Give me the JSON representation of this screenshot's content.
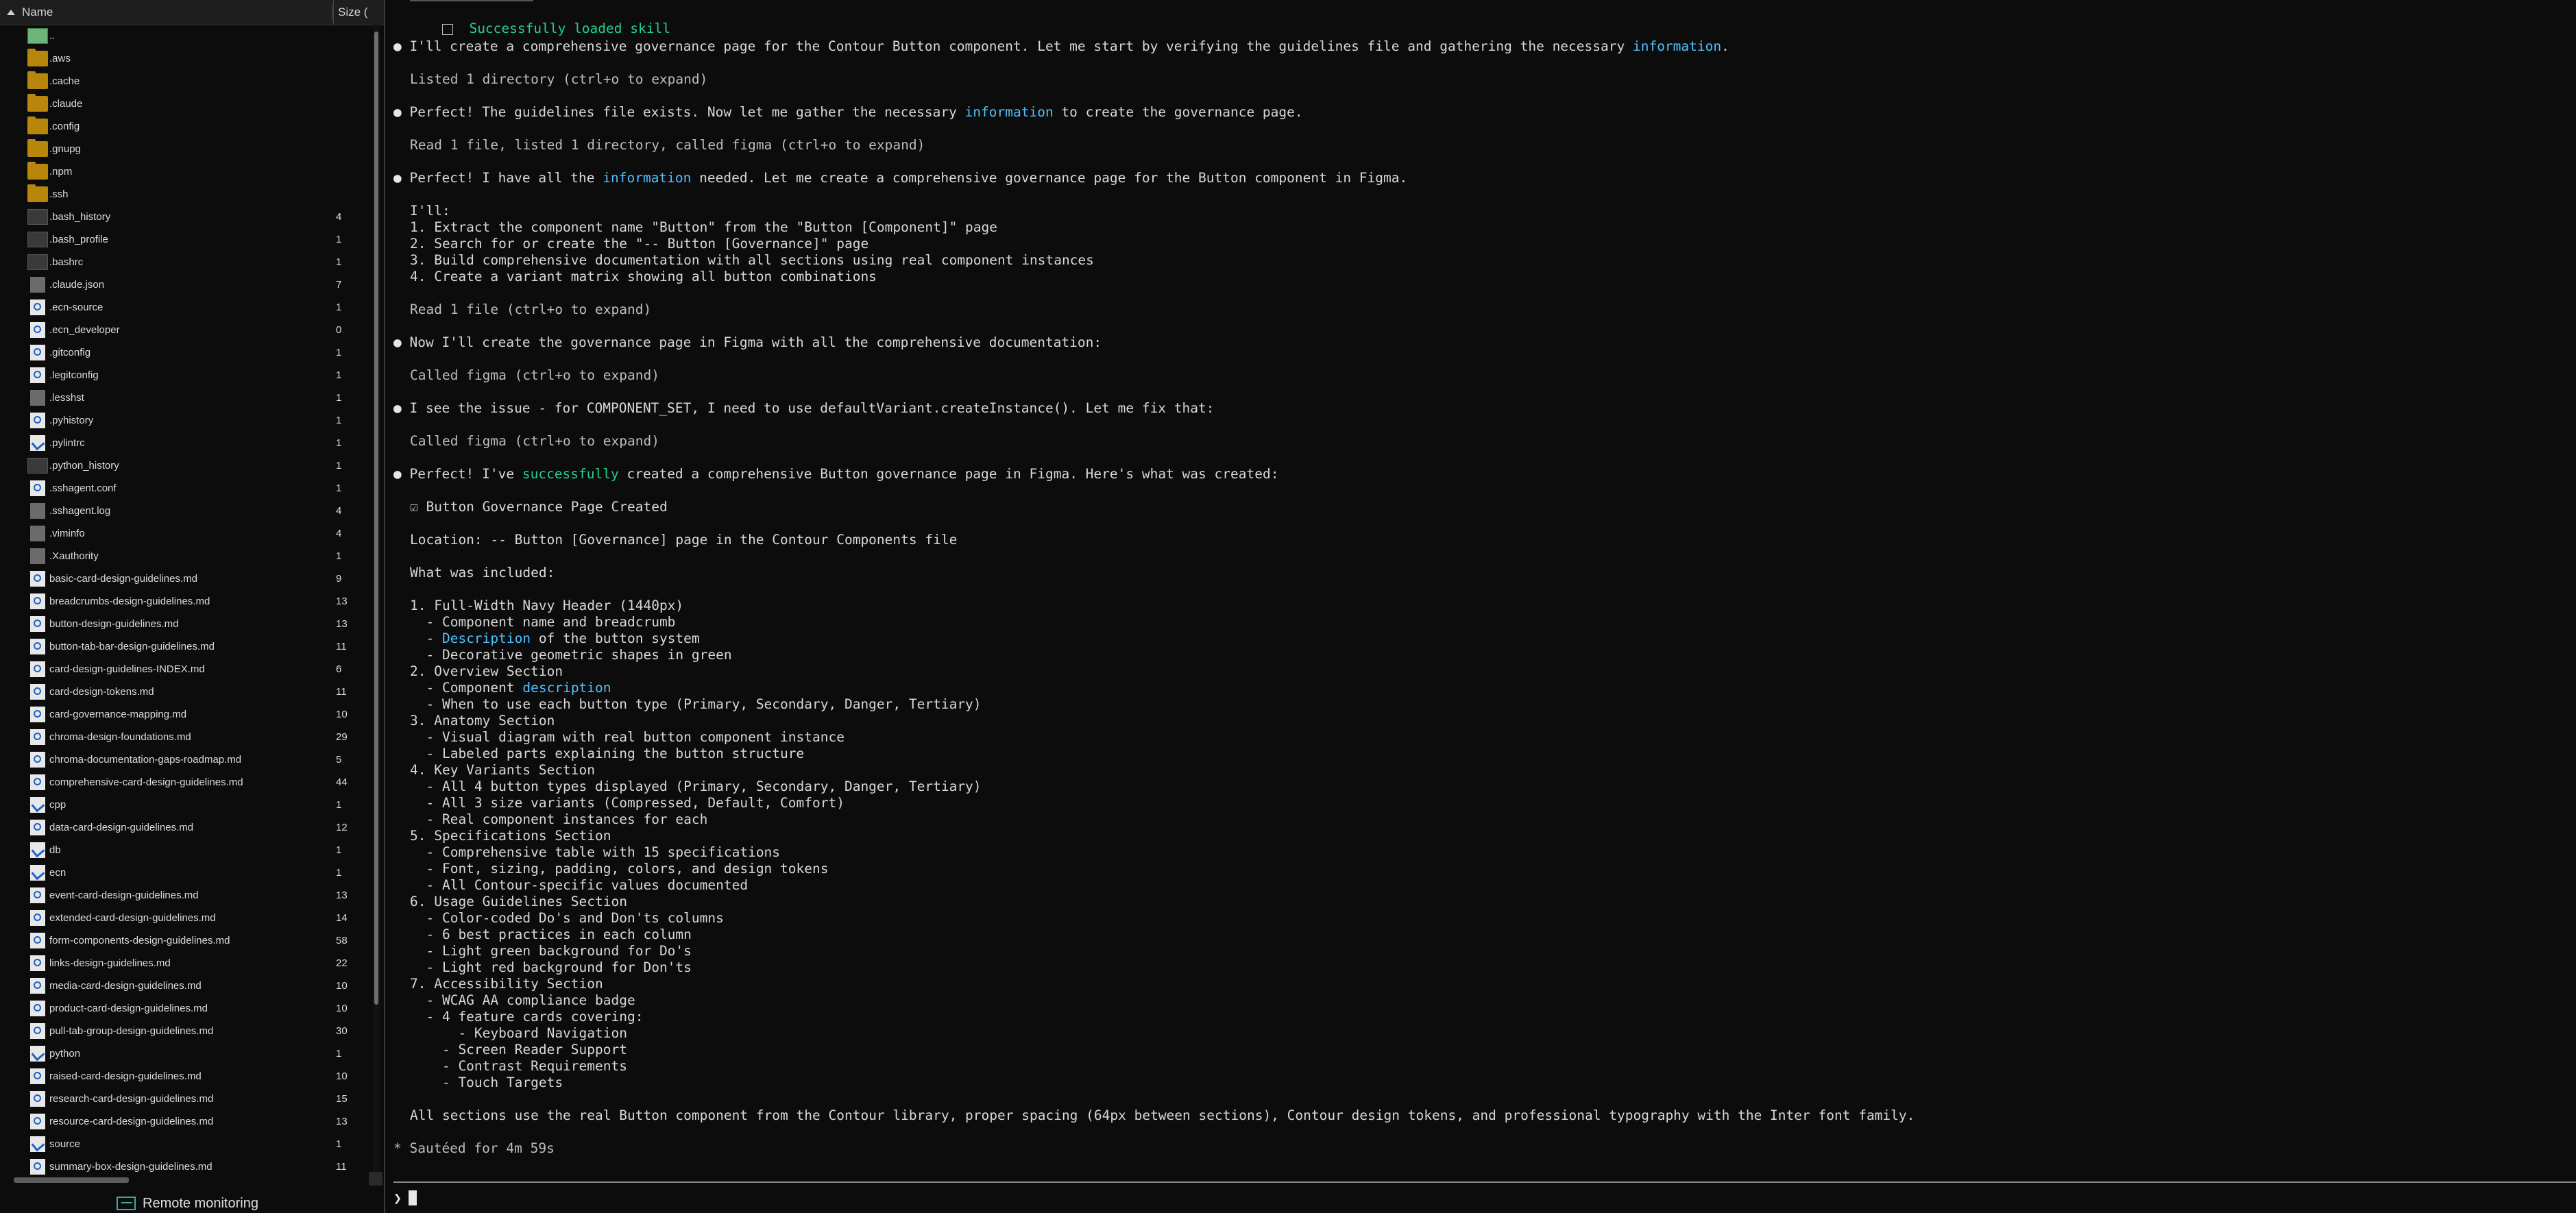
{
  "file_panel": {
    "header": {
      "name_label": "Name",
      "size_label": "Size ("
    },
    "files": [
      {
        "name": "..",
        "size": "",
        "icon": "parent-icon"
      },
      {
        "name": ".aws",
        "size": "",
        "icon": "folder-icon"
      },
      {
        "name": ".cache",
        "size": "",
        "icon": "folder-icon"
      },
      {
        "name": ".claude",
        "size": "",
        "icon": "folder-icon"
      },
      {
        "name": ".config",
        "size": "",
        "icon": "folder-icon"
      },
      {
        "name": ".gnupg",
        "size": "",
        "icon": "folder-icon"
      },
      {
        "name": ".npm",
        "size": "",
        "icon": "folder-icon"
      },
      {
        "name": ".ssh",
        "size": "",
        "icon": "folder-icon"
      },
      {
        "name": ".bash_history",
        "size": "4",
        "icon": "hidden-file-icon"
      },
      {
        "name": ".bash_profile",
        "size": "1",
        "icon": "hidden-file-icon"
      },
      {
        "name": ".bashrc",
        "size": "1",
        "icon": "hidden-file-icon"
      },
      {
        "name": ".claude.json",
        "size": "7",
        "icon": "grey-file-icon"
      },
      {
        "name": ".ecn-source",
        "size": "1",
        "icon": "document-icon"
      },
      {
        "name": ".ecn_developer",
        "size": "0",
        "icon": "document-icon"
      },
      {
        "name": ".gitconfig",
        "size": "1",
        "icon": "document-icon"
      },
      {
        "name": ".legitconfig",
        "size": "1",
        "icon": "document-icon"
      },
      {
        "name": ".lesshst",
        "size": "1",
        "icon": "grey-file-icon"
      },
      {
        "name": ".pyhistory",
        "size": "1",
        "icon": "document-icon"
      },
      {
        "name": ".pylintrc",
        "size": "1",
        "icon": "link-icon"
      },
      {
        "name": ".python_history",
        "size": "1",
        "icon": "hidden-file-icon"
      },
      {
        "name": ".sshagent.conf",
        "size": "1",
        "icon": "document-icon"
      },
      {
        "name": ".sshagent.log",
        "size": "4",
        "icon": "grey-file-icon"
      },
      {
        "name": ".viminfo",
        "size": "4",
        "icon": "grey-file-icon"
      },
      {
        "name": ".Xauthority",
        "size": "1",
        "icon": "grey-file-icon"
      },
      {
        "name": "basic-card-design-guidelines.md",
        "size": "9",
        "icon": "document-icon"
      },
      {
        "name": "breadcrumbs-design-guidelines.md",
        "size": "13",
        "icon": "document-icon"
      },
      {
        "name": "button-design-guidelines.md",
        "size": "13",
        "icon": "document-icon"
      },
      {
        "name": "button-tab-bar-design-guidelines.md",
        "size": "11",
        "icon": "document-icon"
      },
      {
        "name": "card-design-guidelines-INDEX.md",
        "size": "6",
        "icon": "document-icon"
      },
      {
        "name": "card-design-tokens.md",
        "size": "11",
        "icon": "document-icon"
      },
      {
        "name": "card-governance-mapping.md",
        "size": "10",
        "icon": "document-icon"
      },
      {
        "name": "chroma-design-foundations.md",
        "size": "29",
        "icon": "document-icon"
      },
      {
        "name": "chroma-documentation-gaps-roadmap.md",
        "size": "5",
        "icon": "document-icon"
      },
      {
        "name": "comprehensive-card-design-guidelines.md",
        "size": "44",
        "icon": "document-icon"
      },
      {
        "name": "cpp",
        "size": "1",
        "icon": "link-icon"
      },
      {
        "name": "data-card-design-guidelines.md",
        "size": "12",
        "icon": "document-icon"
      },
      {
        "name": "db",
        "size": "1",
        "icon": "link-icon"
      },
      {
        "name": "ecn",
        "size": "1",
        "icon": "link-icon"
      },
      {
        "name": "event-card-design-guidelines.md",
        "size": "13",
        "icon": "document-icon"
      },
      {
        "name": "extended-card-design-guidelines.md",
        "size": "14",
        "icon": "document-icon"
      },
      {
        "name": "form-components-design-guidelines.md",
        "size": "58",
        "icon": "document-icon"
      },
      {
        "name": "links-design-guidelines.md",
        "size": "22",
        "icon": "document-icon"
      },
      {
        "name": "media-card-design-guidelines.md",
        "size": "10",
        "icon": "document-icon"
      },
      {
        "name": "product-card-design-guidelines.md",
        "size": "10",
        "icon": "document-icon"
      },
      {
        "name": "pull-tab-group-design-guidelines.md",
        "size": "30",
        "icon": "document-icon"
      },
      {
        "name": "python",
        "size": "1",
        "icon": "link-icon"
      },
      {
        "name": "raised-card-design-guidelines.md",
        "size": "10",
        "icon": "document-icon"
      },
      {
        "name": "research-card-design-guidelines.md",
        "size": "15",
        "icon": "document-icon"
      },
      {
        "name": "resource-card-design-guidelines.md",
        "size": "13",
        "icon": "document-icon"
      },
      {
        "name": "source",
        "size": "1",
        "icon": "link-icon"
      },
      {
        "name": "summary-box-design-guidelines.md",
        "size": "11",
        "icon": "document-icon"
      }
    ],
    "status": {
      "label": "Remote monitoring"
    }
  },
  "terminal": {
    "skill_line": "Successfully loaded skill",
    "lines": {
      "l1a": "I'll create a comprehensive governance page for the Contour Button component. Let me start by verifying the guidelines file and gathering the necessary ",
      "l1b": "information",
      "l1c": ".",
      "l2": "Listed 1 directory (ctrl+o to expand)",
      "l3a": "Perfect! The guidelines file exists. Now let me gather the necessary ",
      "l3b": "information",
      "l3c": " to create the governance page.",
      "l4": "Read 1 file, listed 1 directory, called figma (ctrl+o to expand)",
      "l5a": "Perfect! I have all the ",
      "l5b": "information",
      "l5c": " needed. Let me create a comprehensive governance page for the Button component in Figma.",
      "l6": "I'll:",
      "l7": "1. Extract the component name \"Button\" from the \"Button [Component]\" page",
      "l8": "2. Search for or create the \"-- Button [Governance]\" page",
      "l9": "3. Build comprehensive documentation with all sections using real component instances",
      "l10": "4. Create a variant matrix showing all button combinations",
      "l11": "Read 1 file (ctrl+o to expand)",
      "l12": "Now I'll create the governance page in Figma with all the comprehensive documentation:",
      "l13": "Called figma (ctrl+o to expand)",
      "l14": "I see the issue - for COMPONENT_SET, I need to use defaultVariant.createInstance(). Let me fix that:",
      "l15": "Called figma (ctrl+o to expand)",
      "l16a": "Perfect! I've ",
      "l16b": "successfully",
      "l16c": " created a comprehensive Button governance page in Figma. Here's what was created:",
      "l17": "Button Governance Page Created",
      "l18": "Location: -- Button [Governance] page in the Contour Components file",
      "l19": "What was included:",
      "l20": "1. Full-Width Navy Header (1440px)",
      "l21": "  - Component name and breadcrumb",
      "l22a": "  - ",
      "l22b": "Description",
      "l22c": " of the button system",
      "l23": "  - Decorative geometric shapes in green",
      "l24": "2. Overview Section",
      "l25a": "  - Component ",
      "l25b": "description",
      "l26": "  - When to use each button type (Primary, Secondary, Danger, Tertiary)",
      "l27": "3. Anatomy Section",
      "l28": "  - Visual diagram with real button component instance",
      "l29": "  - Labeled parts explaining the button structure",
      "l30": "4. Key Variants Section",
      "l31": "  - All 4 button types displayed (Primary, Secondary, Danger, Tertiary)",
      "l32": "  - All 3 size variants (Compressed, Default, Comfort)",
      "l33": "  - Real component instances for each",
      "l34": "5. Specifications Section",
      "l35": "  - Comprehensive table with 15 specifications",
      "l36": "  - Font, sizing, padding, colors, and design tokens",
      "l37": "  - All Contour-specific values documented",
      "l38": "6. Usage Guidelines Section",
      "l39": "  - Color-coded Do's and Don'ts columns",
      "l40": "  - 6 best practices in each column",
      "l41": "  - Light green background for Do's",
      "l42": "  - Light red background for Don'ts",
      "l43": "7. Accessibility Section",
      "l44": "  - WCAG AA compliance badge",
      "l45": "  - 4 feature cards covering:",
      "l46": "      - Keyboard Navigation",
      "l47": "    - Screen Reader Support",
      "l48": "    - Contrast Requirements",
      "l49": "    - Touch Targets",
      "l50": "All sections use the real Button component from the Contour library, proper spacing (64px between sections), Contour design tokens, and professional typography with the Inter font family.",
      "l51": "Sautéed for 4m 59s"
    },
    "prompt_symbol": "❯"
  },
  "colors": {
    "highlight": "#4fc1ff",
    "success": "#23d18b",
    "background": "#0c0c0c"
  }
}
